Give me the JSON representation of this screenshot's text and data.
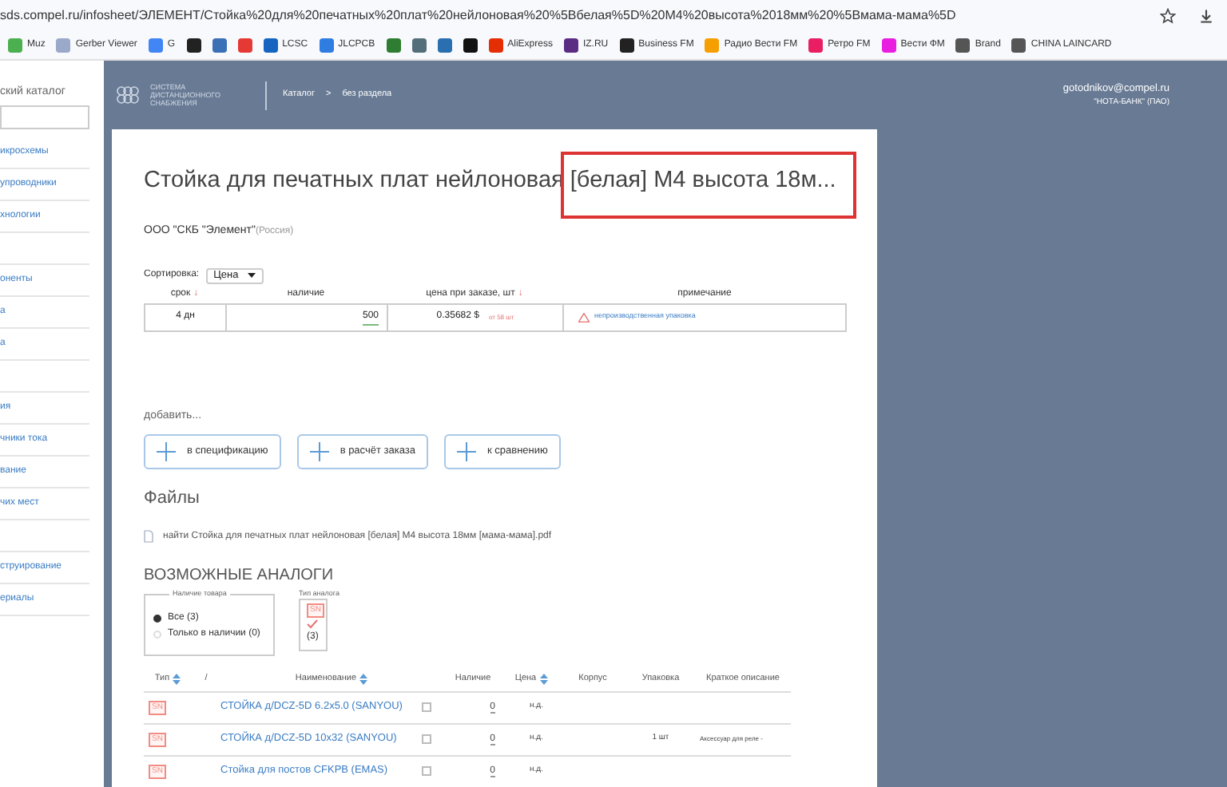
{
  "browser": {
    "url": "sds.compel.ru/infosheet/ЭЛЕМЕНТ/Стойка%20для%20печатных%20плат%20нейлоновая%20%5Bбелая%5D%20M4%20высота%2018мм%20%5Вмама-мама%5D",
    "bookmarks": [
      {
        "label": "Muz",
        "color": "#4caf50"
      },
      {
        "label": "Gerber Viewer",
        "color": "#9aa9c9"
      },
      {
        "label": "G",
        "color": "#4285f4"
      },
      {
        "color": "#222222"
      },
      {
        "color": "#3b6fb6"
      },
      {
        "color": "#e53935"
      },
      {
        "label": "LCSC",
        "color": "#1565c0"
      },
      {
        "label": "JLCPCB",
        "color": "#2f7de1"
      },
      {
        "color": "#2e7d32"
      },
      {
        "color": "#546e7a"
      },
      {
        "color": "#2a6fb0"
      },
      {
        "color": "#111111"
      },
      {
        "label": "AliExpress",
        "color": "#e62e04"
      },
      {
        "label": "IZ.RU",
        "color": "#5b2c83"
      },
      {
        "label": "Business FM",
        "color": "#222222"
      },
      {
        "label": "Радио Вести FM",
        "color": "#f5a000"
      },
      {
        "label": "Ретро FM",
        "color": "#e91e63"
      },
      {
        "label": "Вести ФМ",
        "color": "#e91ee0"
      },
      {
        "label": "Brand",
        "color": "#555555"
      },
      {
        "label": "CHINA LAINCARD",
        "color": "#555555"
      }
    ]
  },
  "sidebar": {
    "title": "ский каталог",
    "items": [
      {
        "kind": "link",
        "label": "икросхемы"
      },
      {
        "kind": "link",
        "label": "упроводники"
      },
      {
        "kind": "link",
        "label": "хнологии"
      },
      {
        "kind": "blank"
      },
      {
        "kind": "link",
        "label": "оненты"
      },
      {
        "kind": "link",
        "label": "а"
      },
      {
        "kind": "link",
        "label": "а"
      },
      {
        "kind": "blank"
      },
      {
        "kind": "link",
        "label": "ия"
      },
      {
        "kind": "link",
        "label": "чники тока"
      },
      {
        "kind": "link",
        "label": "вание"
      },
      {
        "kind": "link",
        "label": "чих мест"
      },
      {
        "kind": "blank"
      },
      {
        "kind": "link",
        "label": "струирование"
      },
      {
        "kind": "link",
        "label": "ериалы"
      }
    ]
  },
  "header": {
    "logo_lines": [
      "СИСТЕМА",
      "ДИСТАНЦИОННОГО",
      "СНАБЖЕНИЯ"
    ],
    "breadcrumbs": [
      "Каталог",
      ">",
      "без раздела"
    ],
    "user_email": "gotodnikov@compel.ru",
    "company": "\"НОТА-БАНК\" (ПАО)"
  },
  "product": {
    "title": "Стойка для печатных плат нейлоновая [белая] M4 высота 18м...",
    "highlighted": true,
    "vendor": "ООО \"СКБ \"Элемент\"",
    "country": "(Россия)"
  },
  "sort": {
    "label": "Сортировка:",
    "value": "Цена"
  },
  "offers": {
    "columns": [
      {
        "label": "срок",
        "arrow": "↓"
      },
      {
        "label": "наличие"
      },
      {
        "label": "цена при заказе, шт",
        "arrow": "↓"
      },
      {
        "label": "примечание"
      }
    ],
    "rows": [
      {
        "term": "4 дн",
        "stock": "500",
        "price": "0.35682 $",
        "min_order": "от 58 шт",
        "note": "непроизводственная упаковка"
      }
    ]
  },
  "add": {
    "label": "добавить...",
    "buttons": [
      "в спецификацию",
      "в расчёт заказа",
      "к сравнению"
    ]
  },
  "files": {
    "heading": "Файлы",
    "items": [
      "найти Стойка для печатных плат нейлоновая [белая] M4 высота 18мм [мама-мама].pdf"
    ]
  },
  "analogs": {
    "heading": "ВОЗМОЖНЫЕ АНАЛОГИ",
    "availability": {
      "legend": "Наличие товара",
      "options": [
        {
          "label": "Все (3)",
          "selected": true
        },
        {
          "label": "Только в наличии (0)",
          "selected": false
        }
      ]
    },
    "type_filter": {
      "legend": "Тип аналога",
      "badge": "SN",
      "checked": true,
      "count": "(3)"
    },
    "columns": [
      "Тип",
      "/",
      "Наименование",
      "Наличие",
      "Цена",
      "Корпус",
      "Упаковка",
      "Краткое описание"
    ],
    "rows": [
      {
        "type": "SN",
        "name": "СТОЙКА д/DCZ-5D 6.2x5.0 (SANYOU)",
        "compare": false,
        "stock": "0",
        "price": "н.д.",
        "package": "",
        "packing": "",
        "description": ""
      },
      {
        "type": "SN",
        "name": "СТОЙКА д/DCZ-5D 10x32 (SANYOU)",
        "compare": false,
        "stock": "0",
        "price": "н.д.",
        "package": "",
        "packing": "1 шт",
        "description": "Аксессуар для реле -"
      },
      {
        "type": "SN",
        "name": "Стойка для постов CFKPB (EMAS)",
        "compare": false,
        "stock": "0",
        "price": "н.д.",
        "package": "",
        "packing": "",
        "description": ""
      }
    ]
  }
}
